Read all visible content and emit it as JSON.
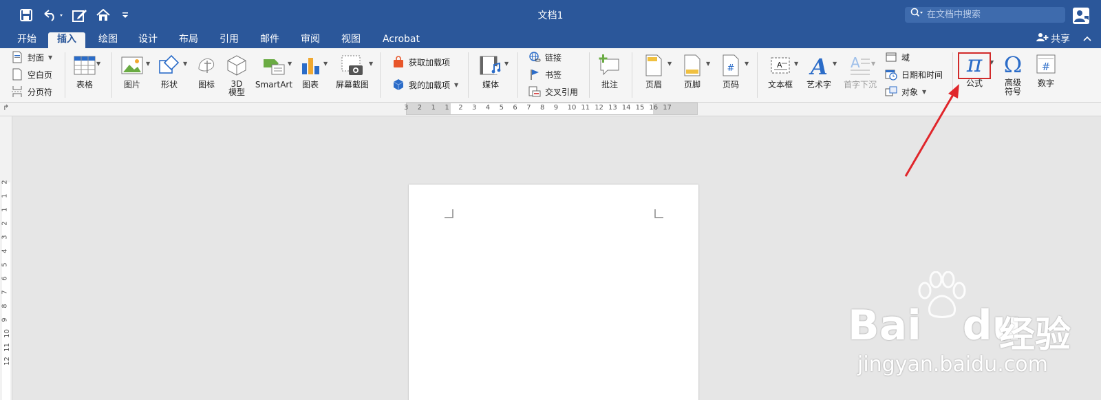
{
  "title_bar": {
    "document_title": "文档1",
    "search_placeholder": "在文档中搜索"
  },
  "tabs": [
    {
      "label": "开始"
    },
    {
      "label": "插入",
      "active": true
    },
    {
      "label": "绘图"
    },
    {
      "label": "设计"
    },
    {
      "label": "布局"
    },
    {
      "label": "引用"
    },
    {
      "label": "邮件"
    },
    {
      "label": "审阅"
    },
    {
      "label": "视图"
    },
    {
      "label": "Acrobat"
    }
  ],
  "share_label": "共享",
  "ribbon": {
    "pages_group": {
      "cover": "封面",
      "blank_page": "空白页",
      "page_break": "分页符"
    },
    "table": "表格",
    "picture": "图片",
    "shapes": "形状",
    "icons": "图标",
    "model_3d": "3D\n模型",
    "smartart": "SmartArt",
    "chart": "图表",
    "screenshot": "屏幕截图",
    "get_addins": "获取加载项",
    "my_addins": "我的加载项",
    "media": "媒体",
    "link": "链接",
    "bookmark": "书签",
    "cross_reference": "交叉引用",
    "comment": "批注",
    "header": "页眉",
    "footer": "页脚",
    "page_number": "页码",
    "text_box": "文本框",
    "wordart": "艺术字",
    "drop_cap": "首字下沉",
    "field": "域",
    "date_time": "日期和时间",
    "object": "对象",
    "equation": "公式",
    "advanced_symbol": "高级\n符号",
    "number": "数字"
  },
  "ruler_numbers": [
    "3",
    "2",
    "1",
    "1",
    "2",
    "3",
    "4",
    "5",
    "6",
    "7",
    "8",
    "9",
    "10",
    "11",
    "12",
    "13",
    "14",
    "15",
    "16",
    "17"
  ],
  "vruler_numbers": [
    "2",
    "1",
    "1",
    "2",
    "3",
    "4",
    "5",
    "6",
    "7",
    "8",
    "9",
    "10",
    "11",
    "12"
  ],
  "watermark": {
    "brand": "Bai",
    "brand2": "du",
    "brand_cn": "经验",
    "url": "jingyan.baidu.com"
  },
  "colors": {
    "title_bar": "#2b579a",
    "ribbon": "#f5f5f5",
    "accent_red": "#d12a2a",
    "icon_blue": "#2b6cc8"
  }
}
